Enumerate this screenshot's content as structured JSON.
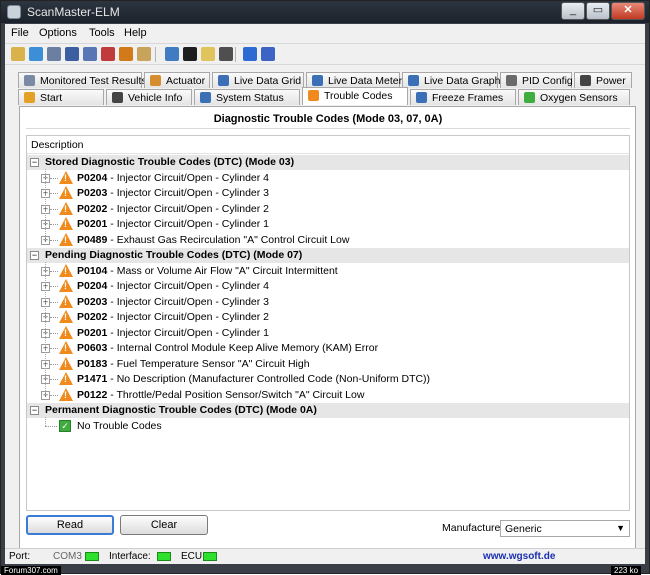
{
  "window": {
    "title": "ScanMaster-ELM"
  },
  "menu": [
    "File",
    "Options",
    "Tools",
    "Help"
  ],
  "toolbar": {
    "icons": [
      {
        "name": "tool-icon",
        "color": "#d9b24c"
      },
      {
        "name": "globe-icon",
        "color": "#3c8fd6"
      },
      {
        "name": "document-icon",
        "color": "#6a7fa1"
      },
      {
        "name": "grid-icon",
        "color": "#3b5fa1"
      },
      {
        "name": "chart-icon",
        "color": "#5876b6"
      },
      {
        "name": "report-icon",
        "color": "#c03b3b"
      },
      {
        "name": "leaf-icon",
        "color": "#d27a1a"
      },
      {
        "name": "clipboard-icon",
        "color": "#c7a35b"
      },
      {
        "name": "chat-icon",
        "color": "#3f7cc2"
      },
      {
        "name": "terminal-icon",
        "color": "#1e1e1e"
      },
      {
        "name": "battery-icon",
        "color": "#e0c35b"
      },
      {
        "name": "disc-icon",
        "color": "#4f4f4f"
      },
      {
        "name": "info-icon",
        "color": "#2d6bd3"
      },
      {
        "name": "book-icon",
        "color": "#3d64c5"
      }
    ]
  },
  "tabs_row1": [
    {
      "label": "Monitored Test Results",
      "icon": "monitor-icon",
      "color": "#7a8aa5"
    },
    {
      "label": "Actuator",
      "icon": "actuator-icon",
      "color": "#d68d2e"
    },
    {
      "label": "Live Data Grid",
      "icon": "grid-icon",
      "color": "#3b6fb6"
    },
    {
      "label": "Live Data Meter",
      "icon": "meter-icon",
      "color": "#3b6fb6"
    },
    {
      "label": "Live Data Graph",
      "icon": "graph-icon",
      "color": "#3b6fb6"
    },
    {
      "label": "PID Config",
      "icon": "pid-icon",
      "color": "#6a6a6a"
    },
    {
      "label": "Power",
      "icon": "power-icon",
      "color": "#444"
    }
  ],
  "tabs_row2": [
    {
      "label": "Start",
      "icon": "start-icon",
      "color": "#e5a126"
    },
    {
      "label": "Vehicle Info",
      "icon": "info-icon",
      "color": "#444"
    },
    {
      "label": "System Status",
      "icon": "status-icon",
      "color": "#3b6fb6"
    },
    {
      "label": "Trouble Codes",
      "icon": "warning-icon",
      "color": "#f08a1c"
    },
    {
      "label": "Freeze Frames",
      "icon": "freeze-icon",
      "color": "#3b6fb6"
    },
    {
      "label": "Oxygen Sensors",
      "icon": "sensor-icon",
      "color": "#3fae3f"
    }
  ],
  "panel": {
    "title": "Diagnostic Trouble Codes (Mode 03, 07, 0A)",
    "column_header": "Description"
  },
  "groups": [
    {
      "label": "Stored Diagnostic Trouble Codes (DTC) (Mode 03)",
      "items": [
        {
          "code": "P0204",
          "desc": " - Injector Circuit/Open - Cylinder 4"
        },
        {
          "code": "P0203",
          "desc": " - Injector Circuit/Open - Cylinder 3"
        },
        {
          "code": "P0202",
          "desc": " - Injector Circuit/Open - Cylinder 2"
        },
        {
          "code": "P0201",
          "desc": " - Injector Circuit/Open - Cylinder 1"
        },
        {
          "code": "P0489",
          "desc": " - Exhaust Gas Recirculation \"A\" Control Circuit Low"
        }
      ]
    },
    {
      "label": "Pending Diagnostic Trouble Codes (DTC) (Mode 07)",
      "items": [
        {
          "code": "P0104",
          "desc": " - Mass or Volume Air Flow \"A\" Circuit Intermittent"
        },
        {
          "code": "P0204",
          "desc": " - Injector Circuit/Open - Cylinder 4"
        },
        {
          "code": "P0203",
          "desc": " - Injector Circuit/Open - Cylinder 3"
        },
        {
          "code": "P0202",
          "desc": " - Injector Circuit/Open - Cylinder 2"
        },
        {
          "code": "P0201",
          "desc": " - Injector Circuit/Open - Cylinder 1"
        },
        {
          "code": "P0603",
          "desc": " - Internal Control Module Keep Alive Memory (KAM) Error"
        },
        {
          "code": "P0183",
          "desc": " - Fuel Temperature Sensor \"A\" Circuit High"
        },
        {
          "code": "P1471",
          "desc": " - No Description (Manufacturer Controlled Code (Non-Uniform DTC))"
        },
        {
          "code": "P0122",
          "desc": " - Throttle/Pedal Position Sensor/Switch \"A\" Circuit Low"
        }
      ]
    },
    {
      "label": "Permanent Diagnostic Trouble Codes (DTC) (Mode 0A)",
      "message": "No Trouble Codes"
    }
  ],
  "buttons": {
    "read": "Read",
    "clear": "Clear"
  },
  "manufacturer": {
    "label": "Manufacturer",
    "value": "Generic"
  },
  "status": {
    "port_label": "Port:",
    "port_value": "COM3",
    "interface_label": "Interface:",
    "ecu_label": "ECU:",
    "link": "www.wgsoft.de"
  },
  "overlays": {
    "left": "Forum307.com",
    "right": "223 ko"
  }
}
